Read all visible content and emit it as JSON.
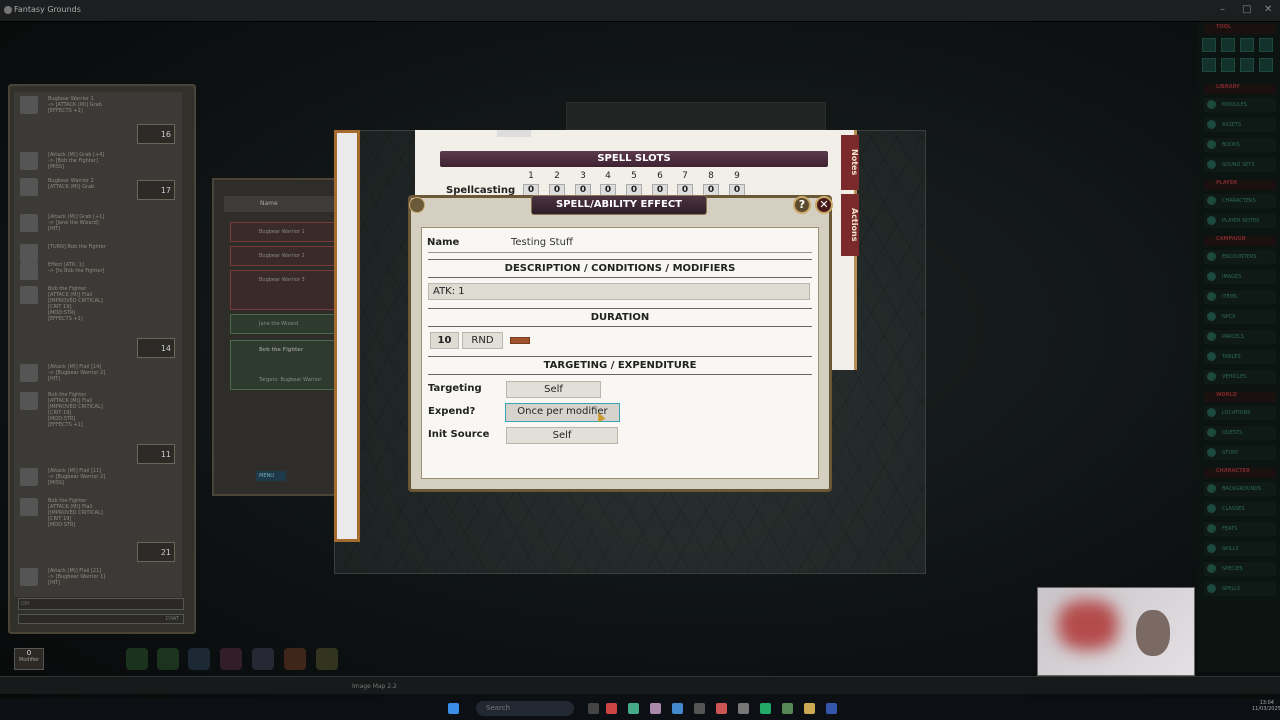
{
  "app": {
    "title": "Fantasy Grounds"
  },
  "chat": {
    "entries": [
      {
        "text": "Bugbear Warrior 1\n-> [ATTACK (M)] Grab\n[EFFECTS +1]",
        "roll": "16"
      },
      {
        "text": "[Attack (M)] Grab [+4]\n-> [Bob the Fighter]\n[MISS]",
        "roll": ""
      },
      {
        "text": "Bugbear Warrior 2\n[ATTACK (M)] Grab",
        "roll": "17"
      },
      {
        "text": "[Attack (M)] Grab [+1]\n-> [Jane the Wizard]\n[HIT]",
        "roll": ""
      },
      {
        "text": "[TURN] Bob the Fighter",
        "roll": ""
      },
      {
        "text": "Effect [ATK: 1]\n-> [to Bob the Fighter]",
        "roll": ""
      },
      {
        "text": "Bob the Fighter\n[ATTACK (M)] Flail\n[IMPROVED CRITICAL]\n[CRIT 19]\n[MOD:STR]\n[EFFECTS +1]",
        "roll": "14"
      },
      {
        "text": "[Attack (M)] Flail [14]\n-> [Bugbear Warrior 2]\n[HIT]",
        "roll": ""
      },
      {
        "text": "Bob the Fighter\n[ATTACK (M)] Flail\n[IMPROVED CRITICAL]\n[CRIT 19]\n[MOD:STR]\n[EFFECTS +1]",
        "roll": "11"
      },
      {
        "text": "[Attack (M)] Flail [11]\n-> [Bugbear Warrior 2]\n[MISS]",
        "roll": ""
      },
      {
        "text": "Bob the Fighter\n[ATTACK (M)] Flail\n[IMPROVED CRITICAL]\n[CRIT 19]\n[MOD:STR]",
        "roll": "21"
      },
      {
        "text": "[Attack (M)] Flail [21]\n-> [Bugbear Warrior 1]\n[HIT]",
        "roll": ""
      }
    ],
    "mode": "GM",
    "chat_label": "CHAT"
  },
  "ct": {
    "name_header": "Name",
    "rows": [
      "Bugbear Warrior 1",
      "Bugbear Warrior 2",
      "Bugbear Warrior 3",
      "Jane the Wizard",
      "Bob the Fighter"
    ],
    "targets": "Targets: Bugbear Warrior",
    "menu": "MENU"
  },
  "sheet": {
    "spell_slots_title": "SPELL SLOTS",
    "spellcasting_label": "Spellcasting",
    "slot_levels": [
      "1",
      "2",
      "3",
      "4",
      "5",
      "6",
      "7",
      "8",
      "9"
    ],
    "slot_values": [
      "0",
      "0",
      "0",
      "0",
      "0",
      "0",
      "0",
      "0",
      "0"
    ],
    "tabs": [
      "Notes",
      "Actions"
    ]
  },
  "dialog": {
    "title": "SPELL/ABILITY EFFECT",
    "help": "?",
    "close": "✕",
    "name_label": "Name",
    "name_value": "Testing Stuff",
    "desc_header": "DESCRIPTION / CONDITIONS / MODIFIERS",
    "desc_value": "ATK: 1",
    "duration_header": "DURATION",
    "duration_value": "10",
    "duration_unit": "RND",
    "targeting_header": "TARGETING / EXPENDITURE",
    "targeting_label": "Targeting",
    "targeting_value": "Self",
    "expend_label": "Expend?",
    "expend_value": "Once per modifier",
    "init_label": "Init Source",
    "init_value": "Self"
  },
  "sidebar": {
    "sections": [
      {
        "header": "TOOL",
        "items": []
      },
      {
        "header": "LIBRARY",
        "items": [
          "MODULES",
          "ASSETS",
          "BOOKS",
          "SOUND SETS"
        ]
      },
      {
        "header": "PLAYER",
        "items": [
          "CHARACTERS",
          "PLAYER NOTES"
        ]
      },
      {
        "header": "CAMPAIGN",
        "items": [
          "ENCOUNTERS",
          "IMAGES",
          "ITEMS",
          "NPCS",
          "PARCELS",
          "TABLES",
          "VEHICLES"
        ]
      },
      {
        "header": "WORLD",
        "items": [
          "LOCATIONS",
          "QUESTS",
          "STORY"
        ]
      },
      {
        "header": "CHARACTER",
        "items": [
          "BACKGROUNDS",
          "CLASSES",
          "FEATS",
          "SKILLS",
          "SPECIES",
          "SPELLS"
        ]
      }
    ]
  },
  "bottom": {
    "modifier_value": "0",
    "modifier_label": "Modifier",
    "map_caption": "Image Map 2.2",
    "search": "Search",
    "time": "13:04",
    "date": "11/03/2025"
  }
}
